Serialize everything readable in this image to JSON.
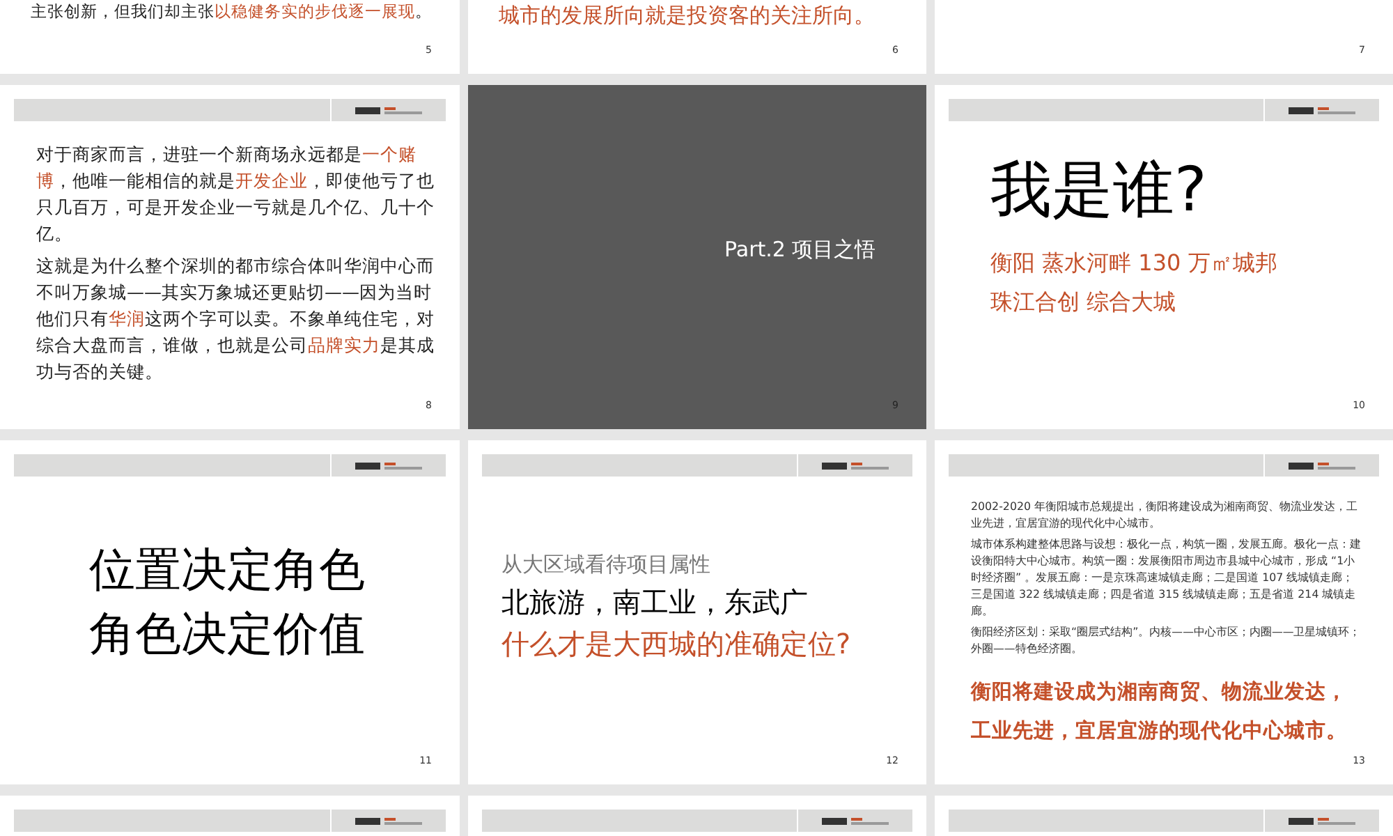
{
  "slides": [
    {
      "kind": "closing",
      "number": "5",
      "blocks": [
        {
          "kind": "tail",
          "segments": [
            {
              "text": "主张创新，但我们却主张",
              "highlight": false
            },
            {
              "text": "以稳健务实的步伐逐一展现",
              "highlight": true
            },
            {
              "text": "。",
              "highlight": false
            }
          ]
        }
      ]
    },
    {
      "kind": "closing",
      "number": "6",
      "blocks": [
        {
          "kind": "lead",
          "segments": [
            {
              "text": "城市的发展所向就是投资客的关注所向。",
              "highlight": true
            }
          ]
        }
      ]
    },
    {
      "kind": "closing",
      "number": "7"
    },
    {
      "kind": "body",
      "number": "8",
      "header": true,
      "blocks": [
        {
          "kind": "body",
          "segments": [
            {
              "text": "对于商家而言，进驻一个新商场永远都是",
              "highlight": false
            },
            {
              "text": "一个赌博",
              "highlight": true
            },
            {
              "text": "，他唯一能相信的就是",
              "highlight": false
            },
            {
              "text": "开发企业",
              "highlight": true
            },
            {
              "text": "，即使他亏了也只几百万，可是开发企业一亏就是几个亿、几十个亿。",
              "highlight": false
            }
          ]
        },
        {
          "kind": "body",
          "segments": [
            {
              "text": "这就是为什么整个深圳的都市综合体叫华润中心而不叫万象城——其实万象城还更贴切——因为当时他们只有",
              "highlight": false
            },
            {
              "text": "华润",
              "highlight": true
            },
            {
              "text": "这两个字可以卖。不象单纯住宅，对综合大盘而言，谁做，也就是公司",
              "highlight": false
            },
            {
              "text": "品牌实力",
              "highlight": true
            },
            {
              "text": "是其成功与否的关键。",
              "highlight": false
            }
          ]
        }
      ]
    },
    {
      "kind": "section",
      "number": "9",
      "header": false,
      "blocks": [
        {
          "kind": "section",
          "segments": [
            {
              "text": "Part.2  项目之悟",
              "highlight": false
            }
          ]
        }
      ]
    },
    {
      "kind": "title",
      "number": "10",
      "header": true,
      "blocks": [
        {
          "kind": "huge",
          "segments": [
            {
              "text": "我是谁?",
              "highlight": false
            }
          ]
        },
        {
          "kind": "tagline",
          "segments": [
            {
              "text": "衡阳   蒸水河畔 130 万㎡城邦",
              "highlight": true
            }
          ]
        },
        {
          "kind": "tagline",
          "segments": [
            {
              "text": "珠江合创   综合大城",
              "highlight": true
            }
          ]
        }
      ]
    },
    {
      "kind": "statement",
      "number": "11",
      "header": true,
      "blocks": [
        {
          "kind": "big",
          "segments": [
            {
              "text": "位置决定角色",
              "highlight": false
            }
          ]
        },
        {
          "kind": "big",
          "segments": [
            {
              "text": "角色决定价值",
              "highlight": false
            }
          ]
        }
      ]
    },
    {
      "kind": "question",
      "number": "12",
      "header": true,
      "blocks": [
        {
          "kind": "muted",
          "segments": [
            {
              "text": "从大区域看待项目属性",
              "highlight": false
            }
          ]
        },
        {
          "kind": "medium",
          "segments": [
            {
              "text": "北旅游，南工业，东武广",
              "highlight": false
            }
          ]
        },
        {
          "kind": "medium",
          "segments": [
            {
              "text": "什么才是大西城的准确定位?",
              "highlight": true
            }
          ]
        }
      ]
    },
    {
      "kind": "summary",
      "number": "13",
      "header": true,
      "blocks": [
        {
          "kind": "small",
          "segments": [
            {
              "text": "2002-2020 年衡阳城市总规提出，衡阳将建设成为湘南商贸、物流业发达，工业先进，宜居宜游的现代化中心城市。",
              "highlight": false
            }
          ]
        },
        {
          "kind": "small",
          "segments": [
            {
              "text": "城市体系构建整体思路与设想：极化一点，构筑一圈，发展五廊。极化一点：建设衡阳特大中心城市。构筑一圈：发展衡阳市周边市县城中心城市，形成 “1小时经济圈” 。发展五廊：一是京珠高速城镇走廊；二是国道 107 线城镇走廊；三是国道 322 线城镇走廊；四是省道 315 线城镇走廊；五是省道 214 城镇走廊。",
              "highlight": false
            }
          ]
        },
        {
          "kind": "small",
          "segments": [
            {
              "text": "衡阳经济区划：采取“圈层式结构”。内核——中心市区；内圈——卫星城镇环；外圈——特色经济圈。",
              "highlight": false
            }
          ]
        },
        {
          "kind": "strong",
          "segments": [
            {
              "text": "衡阳将建设成为湘南商贸、物流业发达，工业先进，宜居宜游的现代化中心城市。",
              "highlight": true
            }
          ]
        }
      ]
    },
    {
      "kind": "blank",
      "header": true
    },
    {
      "kind": "blank",
      "header": true
    },
    {
      "kind": "blank",
      "header": true
    }
  ]
}
